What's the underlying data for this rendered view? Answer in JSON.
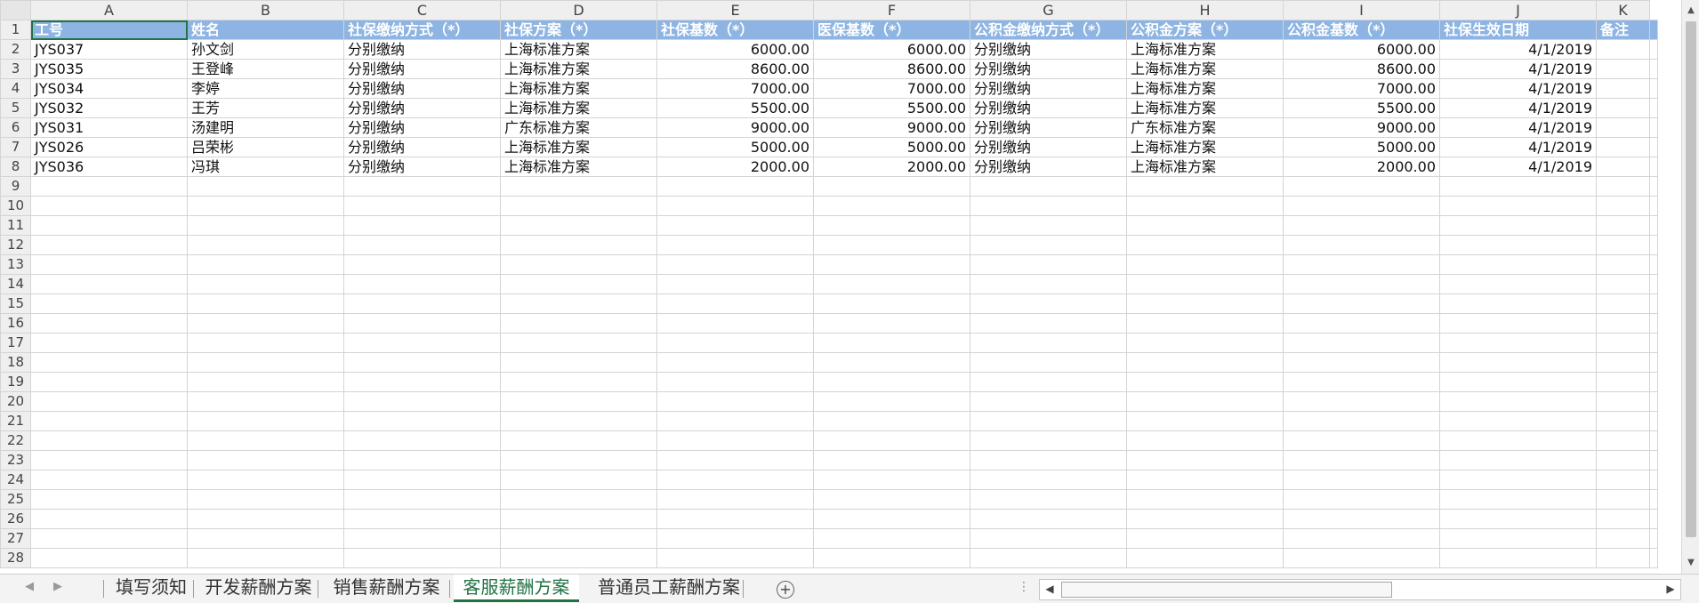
{
  "columns": [
    "A",
    "B",
    "C",
    "D",
    "E",
    "F",
    "G",
    "H",
    "I",
    "J",
    "K"
  ],
  "header_row": [
    "工号",
    "姓名",
    "社保缴纳方式（*）",
    "社保方案（*）",
    "社保基数（*）",
    "医保基数（*）",
    "公积金缴纳方式（*）",
    "公积金方案（*）",
    "公积金基数（*）",
    "社保生效日期",
    "备注"
  ],
  "rows": [
    [
      "JYS037",
      "孙文剑",
      "分别缴纳",
      "上海标准方案",
      "6000.00",
      "6000.00",
      "分别缴纳",
      "上海标准方案",
      "6000.00",
      "4/1/2019",
      ""
    ],
    [
      "JYS035",
      "王登峰",
      "分别缴纳",
      "上海标准方案",
      "8600.00",
      "8600.00",
      "分别缴纳",
      "上海标准方案",
      "8600.00",
      "4/1/2019",
      ""
    ],
    [
      "JYS034",
      "李婷",
      "分别缴纳",
      "上海标准方案",
      "7000.00",
      "7000.00",
      "分别缴纳",
      "上海标准方案",
      "7000.00",
      "4/1/2019",
      ""
    ],
    [
      "JYS032",
      "王芳",
      "分别缴纳",
      "上海标准方案",
      "5500.00",
      "5500.00",
      "分别缴纳",
      "上海标准方案",
      "5500.00",
      "4/1/2019",
      ""
    ],
    [
      "JYS031",
      "汤建明",
      "分别缴纳",
      "广东标准方案",
      "9000.00",
      "9000.00",
      "分别缴纳",
      "广东标准方案",
      "9000.00",
      "4/1/2019",
      ""
    ],
    [
      "JYS026",
      "吕荣彬",
      "分别缴纳",
      "上海标准方案",
      "5000.00",
      "5000.00",
      "分别缴纳",
      "上海标准方案",
      "5000.00",
      "4/1/2019",
      ""
    ],
    [
      "JYS036",
      "冯琪",
      "分别缴纳",
      "上海标准方案",
      "2000.00",
      "2000.00",
      "分别缴纳",
      "上海标准方案",
      "2000.00",
      "4/1/2019",
      ""
    ]
  ],
  "numeric_columns": [
    4,
    5,
    8,
    9
  ],
  "row_numbers": [
    "1",
    "2",
    "3",
    "4",
    "5",
    "6",
    "7",
    "8",
    "9",
    "10",
    "11",
    "12",
    "13",
    "14",
    "15",
    "16",
    "17",
    "18",
    "19",
    "20",
    "21",
    "22",
    "23",
    "24",
    "25",
    "26",
    "27",
    "28"
  ],
  "active_cell": "A1",
  "sheet_tabs": [
    {
      "label": "填写须知",
      "active": false
    },
    {
      "label": "开发薪酬方案",
      "active": false
    },
    {
      "label": "销售薪酬方案",
      "active": false
    },
    {
      "label": "客服薪酬方案",
      "active": true
    },
    {
      "label": "普通员工薪酬方案",
      "active": false
    }
  ],
  "icons": {
    "add_sheet": "plus-circle-icon",
    "nav_prev": "triangle-left-icon",
    "nav_next": "triangle-right-icon"
  },
  "colors": {
    "header_fill": "#8db4e2",
    "accent": "#217346"
  }
}
